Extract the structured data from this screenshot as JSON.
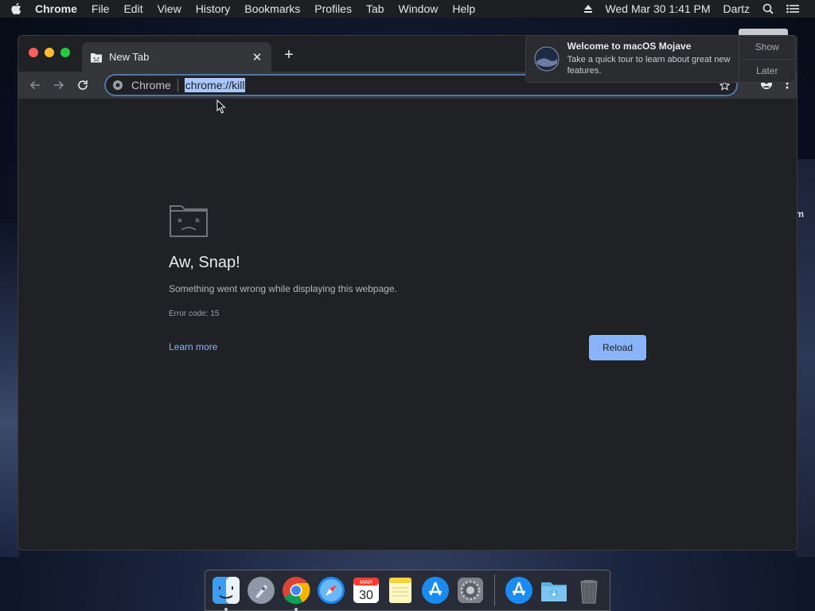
{
  "menubar": {
    "app_name": "Chrome",
    "items": [
      "File",
      "Edit",
      "View",
      "History",
      "Bookmarks",
      "Profiles",
      "Tab",
      "Window",
      "Help"
    ],
    "clock": "Wed Mar 30  1:41 PM",
    "user": "Dartz",
    "icons": [
      "apple-icon",
      "eject-icon",
      "spotlight-search-icon",
      "notification-center-icon"
    ]
  },
  "tab": {
    "title": "New Tab"
  },
  "omnibox": {
    "chip": "Chrome",
    "url": "chrome://kill"
  },
  "error_page": {
    "heading": "Aw, Snap!",
    "description": "Something went wrong while displaying this webpage.",
    "error_code": "Error code: 15",
    "learn_more": "Learn more",
    "reload": "Reload"
  },
  "notification": {
    "title": "Welcome to macOS Mojave",
    "text": "Take a quick tour to learn about great new features.",
    "show": "Show",
    "later": "Later"
  },
  "desktop": {
    "partial_label": "m"
  },
  "dock": {
    "items": [
      "finder",
      "launchpad",
      "chrome",
      "safari",
      "calendar",
      "notes",
      "app-store",
      "system-preferences",
      "app-store-2",
      "downloads",
      "trash"
    ],
    "calendar_month": "MAR",
    "calendar_day": "30"
  },
  "colors": {
    "accent": "#8ab4f8",
    "window_bg": "#202124",
    "toolbar_bg": "#35363a"
  }
}
